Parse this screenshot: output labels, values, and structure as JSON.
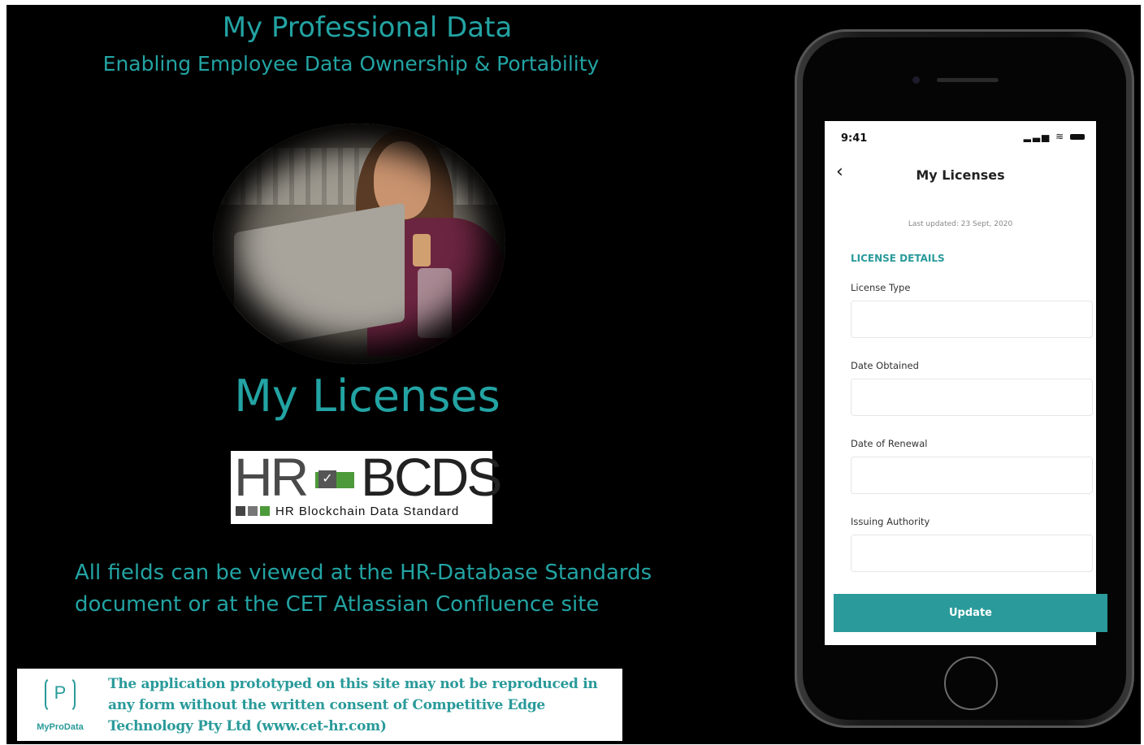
{
  "slide": {
    "title": "My Professional Data",
    "subtitle": "Enabling Employee Data Ownership & Portability",
    "page_heading": "My Licenses",
    "logo": {
      "letters_left": "HR",
      "letters_right": "BCDS",
      "tagline": "HR Blockchain Data Standard"
    },
    "note_line1": "All fields can be viewed at the HR-Database Standards",
    "note_line2": "document or at the CET Atlassian Confluence site",
    "disclaimer": {
      "brand_letter": "P",
      "brand_name": "MyProData",
      "line1": "The application prototyped on this site may not be reproduced in",
      "line2": "any form without the written consent of Competitive Edge",
      "line3": "Technology Pty Ltd (www.cet-hr.com)"
    }
  },
  "phone": {
    "status_time": "9:41",
    "nav_title": "My Licenses",
    "last_updated": "Last updated: 23 Sept, 2020",
    "section_title": "LICENSE DETAILS",
    "fields": [
      {
        "label": "License Type",
        "value": ""
      },
      {
        "label": "Date Obtained",
        "value": ""
      },
      {
        "label": "Date of Renewal",
        "value": ""
      },
      {
        "label": "Issuing Authority",
        "value": ""
      }
    ],
    "update_label": "Update"
  },
  "colors": {
    "accent": "#2a9a9a",
    "title_teal": "#23a3a3",
    "background": "#000000"
  },
  "icons": {
    "back": "chevron-left-icon",
    "signal": "signal-icon",
    "wifi": "wifi-icon",
    "battery": "battery-icon"
  }
}
